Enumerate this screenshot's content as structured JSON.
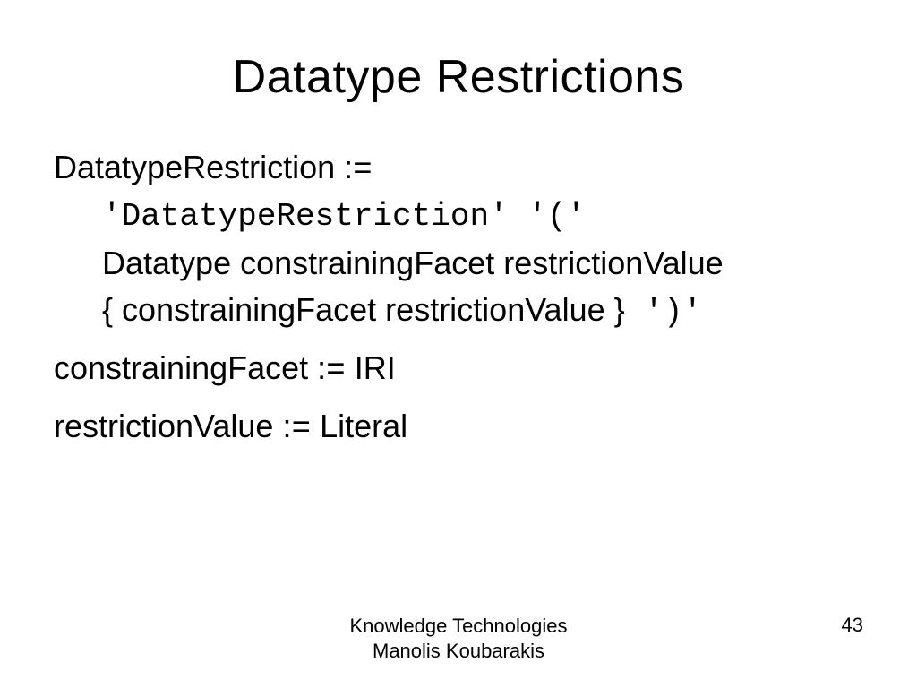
{
  "title": "Datatype Restrictions",
  "body": {
    "l1a": "DatatypeRestriction :",
    "l1b": "=",
    "l2": "'DatatypeRestriction' '('",
    "l3": "Datatype constrainingFacet restrictionValue",
    "l4a": "{ constrainingFacet restrictionValue }",
    "l4b": " ')'",
    "l5a": "constrainingFacet :",
    "l5b": "=",
    "l5c": " IRI",
    "l6a": "restrictionValue :",
    "l6b": "=",
    "l6c": " Literal"
  },
  "footer": {
    "line1": "Knowledge Technologies",
    "line2": "Manolis Koubarakis",
    "page": "43"
  }
}
